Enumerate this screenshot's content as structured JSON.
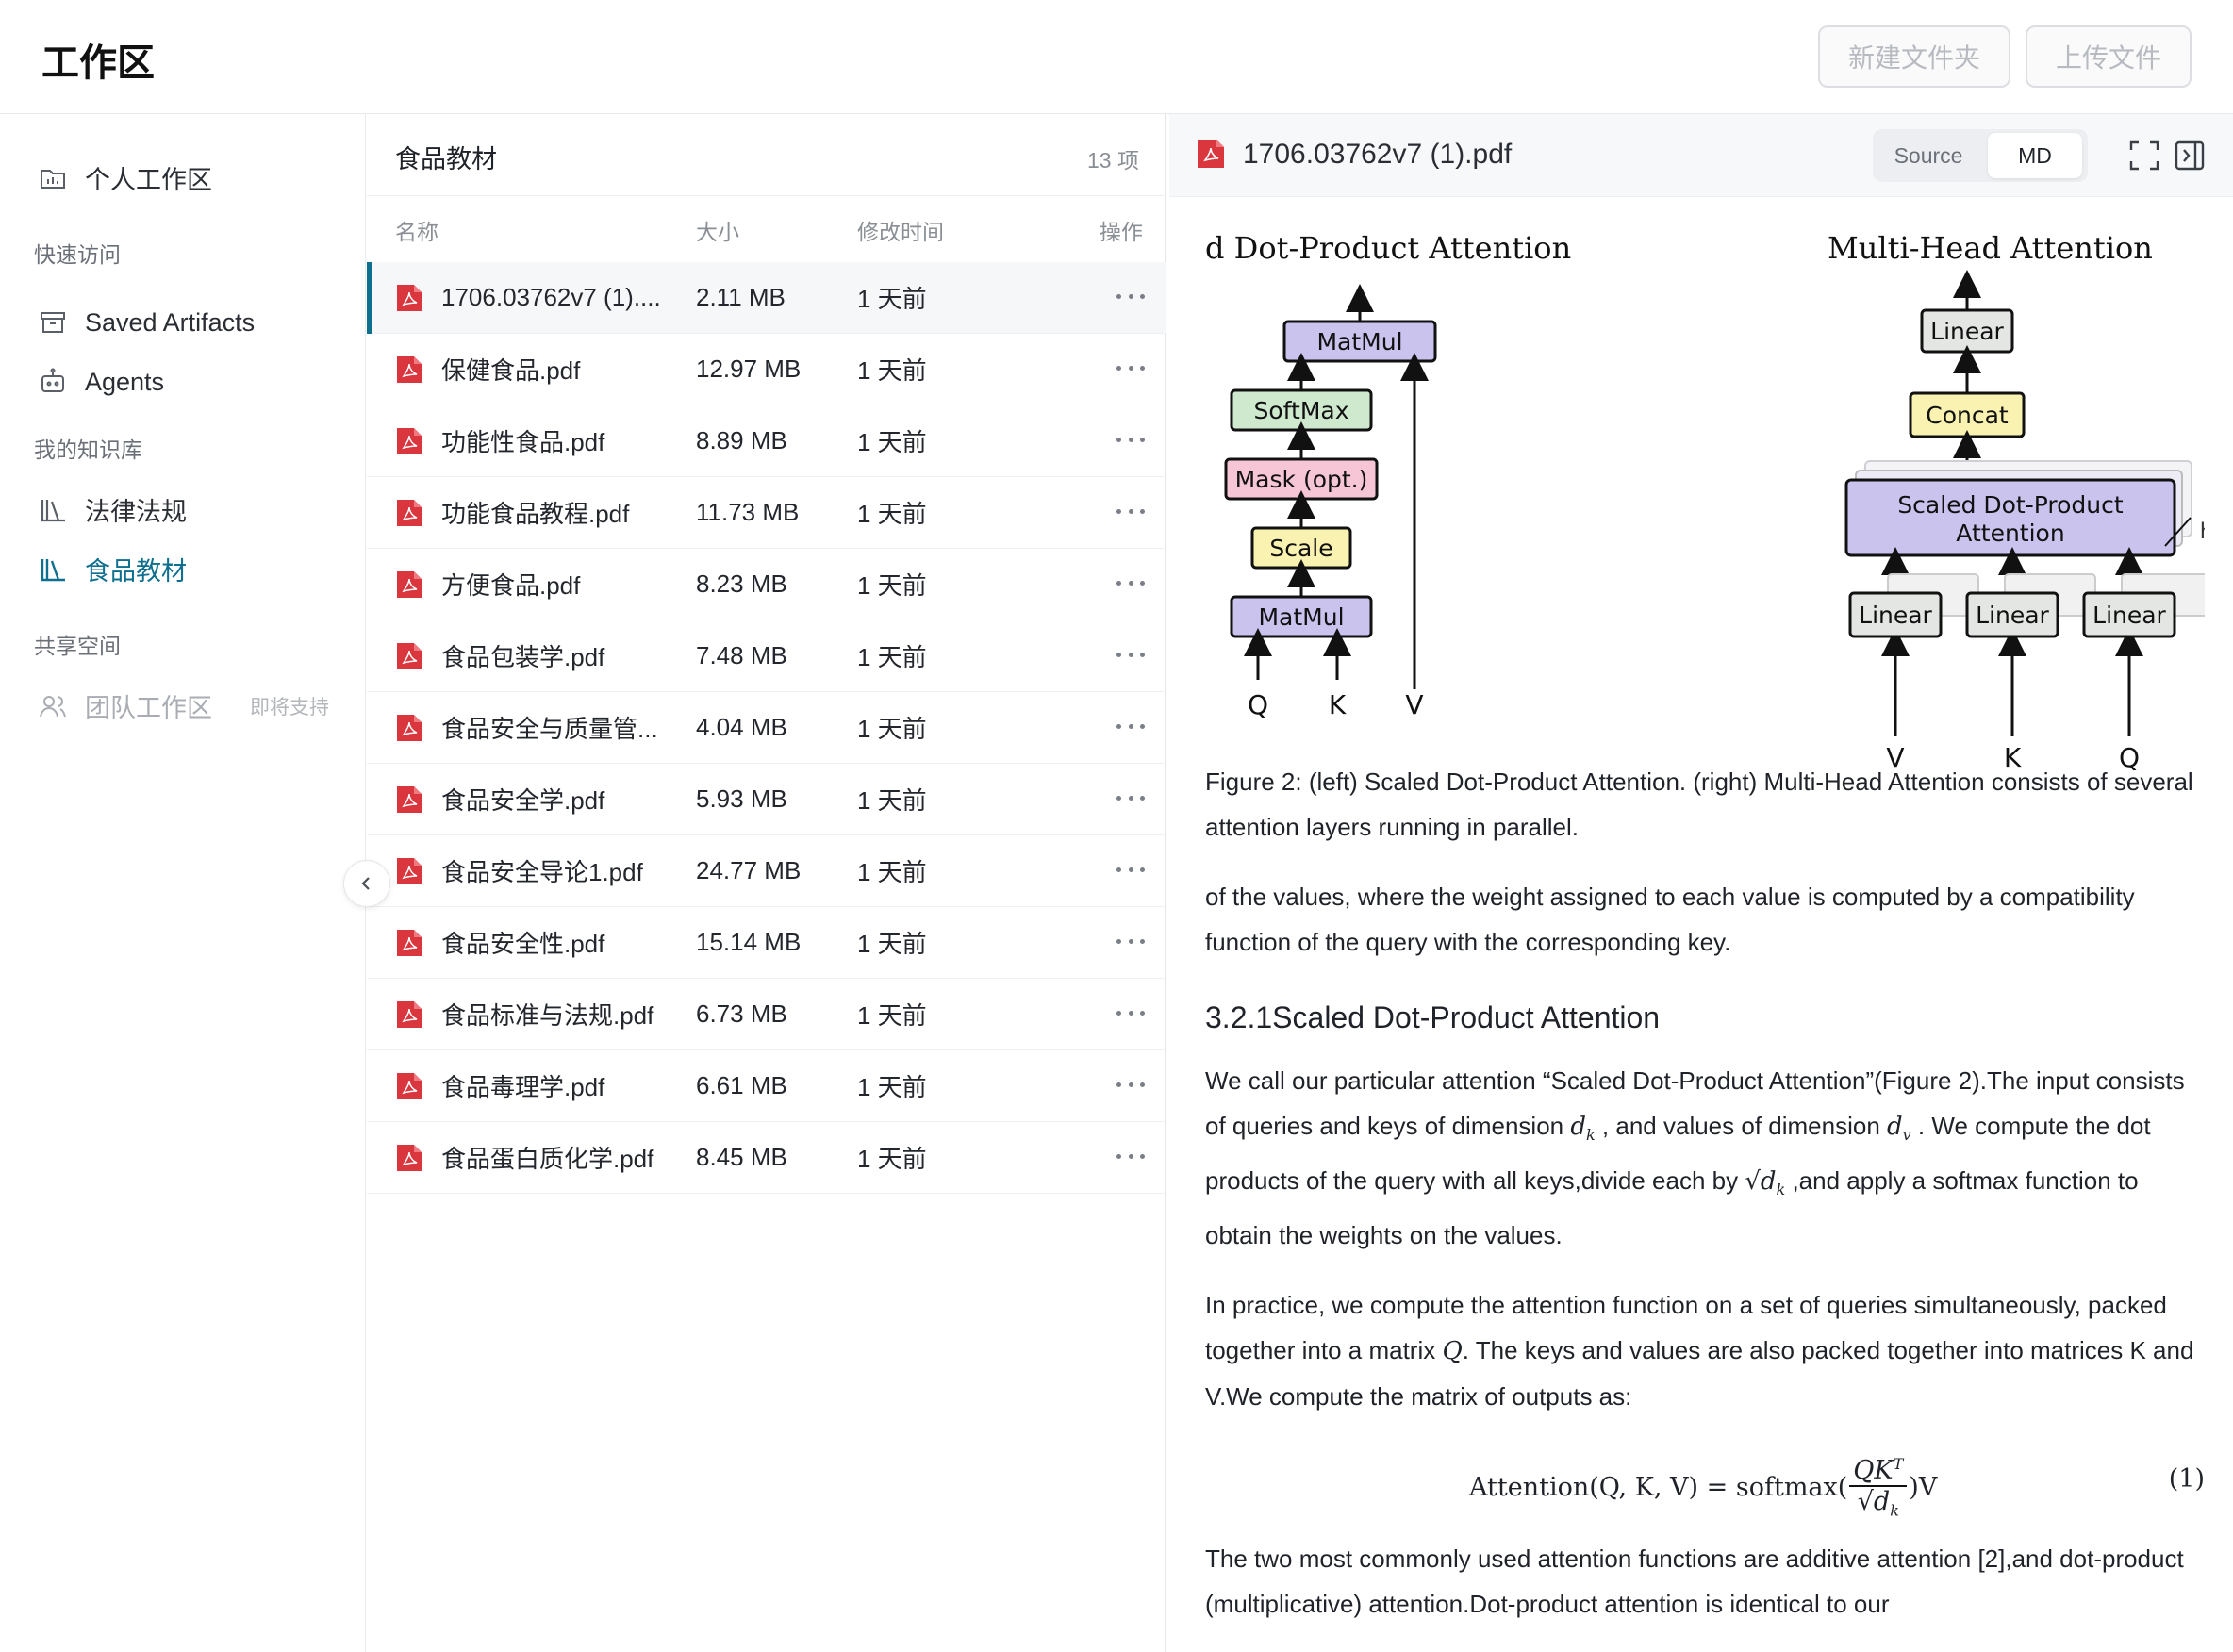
{
  "app": {
    "title": "工作区",
    "new_folder": "新建文件夹",
    "upload": "上传文件"
  },
  "sidebar": {
    "personal": "个人工作区",
    "quick_access": "快速访问",
    "saved": "Saved Artifacts",
    "agents": "Agents",
    "kb_title": "我的知识库",
    "kb_items": [
      "法律法规",
      "食品教材"
    ],
    "shared_title": "共享空间",
    "team": "团队工作区",
    "team_soon": "即将支持"
  },
  "filelist": {
    "title": "食品教材",
    "count": "13 项",
    "columns": {
      "name": "名称",
      "size": "大小",
      "modified": "修改时间",
      "actions": "操作"
    },
    "files": [
      {
        "name": "1706.03762v7 (1)....",
        "size": "2.11 MB",
        "time": "1 天前"
      },
      {
        "name": "保健食品.pdf",
        "size": "12.97 MB",
        "time": "1 天前"
      },
      {
        "name": "功能性食品.pdf",
        "size": "8.89 MB",
        "time": "1 天前"
      },
      {
        "name": "功能食品教程.pdf",
        "size": "11.73 MB",
        "time": "1 天前"
      },
      {
        "name": "方便食品.pdf",
        "size": "8.23 MB",
        "time": "1 天前"
      },
      {
        "name": "食品包装学.pdf",
        "size": "7.48 MB",
        "time": "1 天前"
      },
      {
        "name": "食品安全与质量管...",
        "size": "4.04 MB",
        "time": "1 天前"
      },
      {
        "name": "食品安全学.pdf",
        "size": "5.93 MB",
        "time": "1 天前"
      },
      {
        "name": "食品安全导论1.pdf",
        "size": "24.77 MB",
        "time": "1 天前"
      },
      {
        "name": "食品安全性.pdf",
        "size": "15.14 MB",
        "time": "1 天前"
      },
      {
        "name": "食品标准与法规.pdf",
        "size": "6.73 MB",
        "time": "1 天前"
      },
      {
        "name": "食品毒理学.pdf",
        "size": "6.61 MB",
        "time": "1 天前"
      },
      {
        "name": "食品蛋白质化学.pdf",
        "size": "8.45 MB",
        "time": "1 天前"
      }
    ]
  },
  "viewer": {
    "filename": "1706.03762v7 (1).pdf",
    "mode_source": "Source",
    "mode_md": "MD",
    "figure": {
      "left_title": "d Dot-Product Attention",
      "right_title": "Multi-Head Attention",
      "left_blocks": [
        "MatMul",
        "SoftMax",
        "Mask (opt.)",
        "Scale",
        "MatMul"
      ],
      "left_inputs": [
        "Q",
        "K",
        "V"
      ],
      "right_blocks": {
        "linear_top": "Linear",
        "concat": "Concat",
        "sdpa": "Scaled Dot-Product\nAttention",
        "h": "h",
        "linear": "Linear"
      },
      "right_inputs": [
        "V",
        "K",
        "Q"
      ]
    },
    "caption": "Figure 2: (left) Scaled Dot-Product Attention. (right) Multi-Head Attention consists of several attention layers running in parallel.",
    "para1": "of the values, where the weight assigned to each value is computed by a compatibility function of the query with the corresponding key.",
    "heading": "3.2.1Scaled Dot-Product Attention",
    "para2": {
      "a": "We call our particular attention “Scaled Dot-Product Attention”(Figure 2).The input consists of queries and keys of dimension ",
      "b": " , and values of dimension ",
      "c": " . We compute the dot products of the query with all keys,divide each by ",
      "d": " ,and apply a softmax function to obtain the weights on the values."
    },
    "para3": {
      "a": "In practice, we compute the attention function on a set of queries simultaneously, packed together into a matrix ",
      "b": ". The keys and values are also packed together into matrices K and V.We compute the matrix of outputs as:"
    },
    "equation": {
      "lhs": "Attention(Q, K, V) = softmax(",
      "num": "QK",
      "sup": "T",
      "den": "√d",
      "sub": "k",
      "rhs": ")V",
      "number": "(1)"
    },
    "para4": "The two most commonly used attention functions are additive attention [2],and dot-product (multiplicative) attention.Dot-product attention is identical to our"
  }
}
